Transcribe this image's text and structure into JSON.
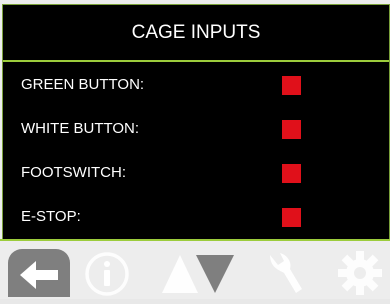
{
  "screen": {
    "title": "CAGE INPUTS"
  },
  "inputs": [
    {
      "label": "GREEN BUTTON:",
      "state": "off",
      "color": "#e0101a"
    },
    {
      "label": "WHITE BUTTON:",
      "state": "off",
      "color": "#e0101a"
    },
    {
      "label": "FOOTSWITCH:",
      "state": "off",
      "color": "#e0101a"
    },
    {
      "label": "E-STOP:",
      "state": "off",
      "color": "#e0101a"
    }
  ],
  "nav": {
    "icons": [
      "back-arrow-icon",
      "info-icon",
      "up-down-icon",
      "wrench-icon",
      "gear-icon"
    ]
  },
  "colors": {
    "accent": "#9ccc3c",
    "indicator_off": "#e0101a",
    "background": "#000000"
  }
}
